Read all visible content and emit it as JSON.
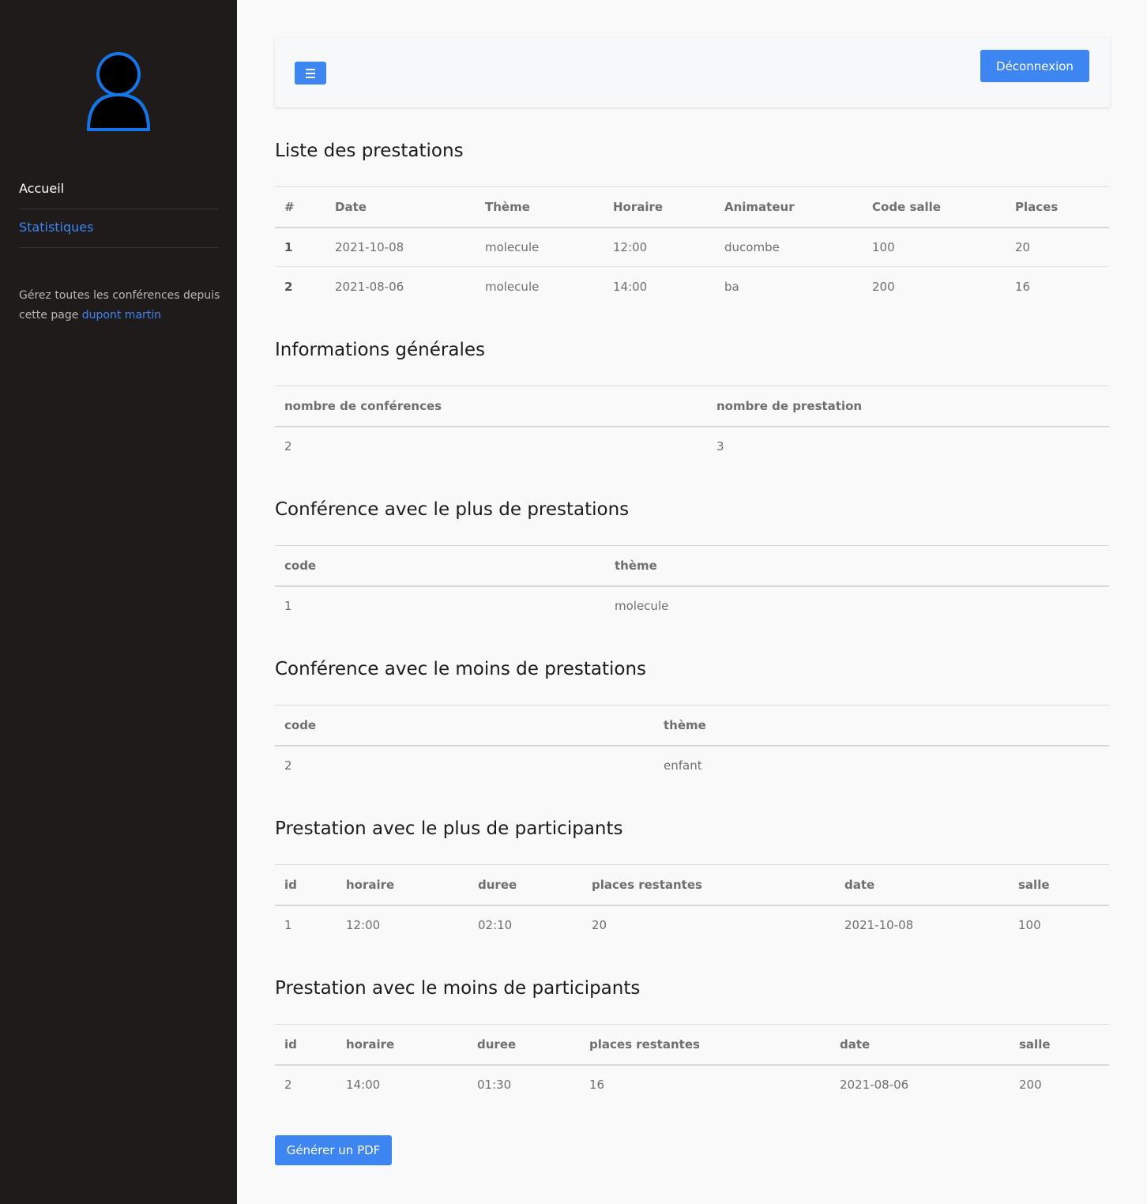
{
  "sidebar": {
    "nav": [
      "Accueil",
      "Statistiques"
    ],
    "note_text": "Gérez toutes les conférences depuis cette page",
    "note_user": "dupont martin"
  },
  "header": {
    "logout_label": "Déconnexion"
  },
  "sections": {
    "prestations": {
      "title": "Liste des prestations",
      "headers": [
        "#",
        "Date",
        "Thème",
        "Horaire",
        "Animateur",
        "Code salle",
        "Places"
      ],
      "rows": [
        [
          "1",
          "2021-10-08",
          "molecule",
          "12:00",
          "ducombe",
          "100",
          "20"
        ],
        [
          "2",
          "2021-08-06",
          "molecule",
          "14:00",
          "ba",
          "200",
          "16"
        ]
      ]
    },
    "infos": {
      "title": "Informations générales",
      "headers": [
        "nombre de conférences",
        "nombre de prestation"
      ],
      "rows": [
        [
          "2",
          "3"
        ]
      ]
    },
    "conf_plus": {
      "title": "Conférence avec le plus de prestations",
      "headers": [
        "code",
        "thème"
      ],
      "rows": [
        [
          "1",
          "molecule"
        ]
      ]
    },
    "conf_moins": {
      "title": "Conférence avec le moins de prestations",
      "headers": [
        "code",
        "thème"
      ],
      "rows": [
        [
          "2",
          "enfant"
        ]
      ]
    },
    "presta_plus": {
      "title": "Prestation avec le plus de participants",
      "headers": [
        "id",
        "horaire",
        "duree",
        "places restantes",
        "date",
        "salle"
      ],
      "rows": [
        [
          "1",
          "12:00",
          "02:10",
          "20",
          "2021-10-08",
          "100"
        ]
      ]
    },
    "presta_moins": {
      "title": "Prestation avec le moins de participants",
      "headers": [
        "id",
        "horaire",
        "duree",
        "places restantes",
        "date",
        "salle"
      ],
      "rows": [
        [
          "2",
          "14:00",
          "01:30",
          "16",
          "2021-08-06",
          "200"
        ]
      ]
    }
  },
  "pdf_label": "Générer un PDF",
  "colors": {
    "accent": "#3d86f2",
    "sidebar_bg": "#1f1b1b",
    "page_bg": "#f9f9f9"
  }
}
